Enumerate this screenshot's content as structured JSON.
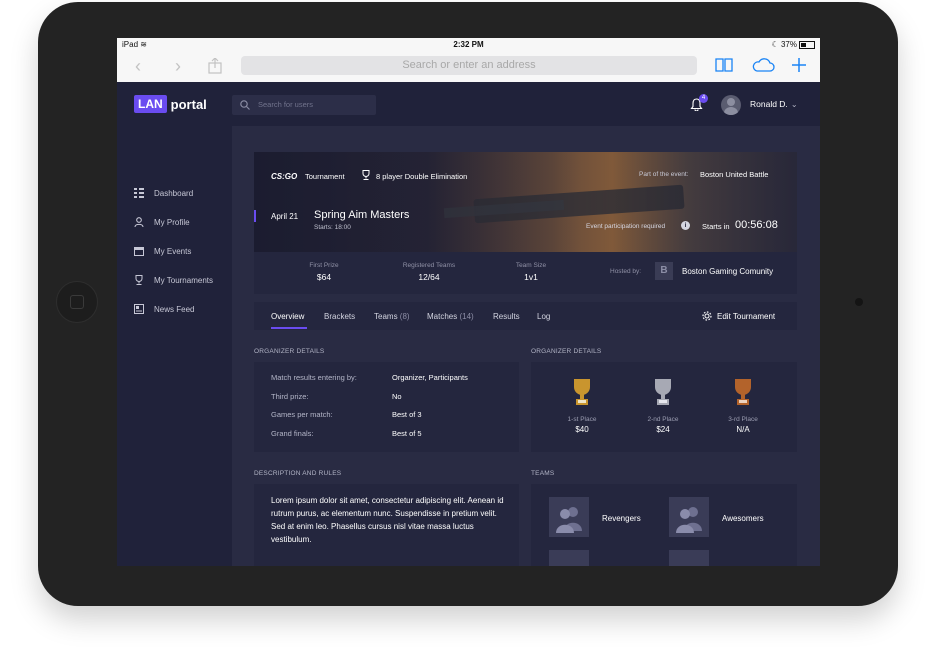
{
  "status_bar": {
    "device": "iPad",
    "time": "2:32 PM",
    "battery": "37%"
  },
  "browser": {
    "address_placeholder": "Search or enter an address"
  },
  "header": {
    "logo_lan": "LAN",
    "logo_portal": "portal",
    "search_placeholder": "Search for users",
    "notification_count": "4",
    "user_name": "Ronald D."
  },
  "sidebar": {
    "items": [
      {
        "label": "Dashboard",
        "icon": "dashboard-icon"
      },
      {
        "label": "My Profile",
        "icon": "profile-icon"
      },
      {
        "label": "My Events",
        "icon": "calendar-icon"
      },
      {
        "label": "My Tournaments",
        "icon": "trophy-icon"
      },
      {
        "label": "News Feed",
        "icon": "news-icon"
      }
    ]
  },
  "hero": {
    "game": "CS:GO",
    "type_label": "Tournament",
    "format": "8 player Double Elimination",
    "event_label": "Part of the event:",
    "event_name": "Boston United Battle",
    "date": "April 21",
    "title": "Spring Aim Masters",
    "starts_time": "Starts: 18:00",
    "participation_note": "Event participation required",
    "countdown_label": "Starts in",
    "countdown": "00:56:08"
  },
  "stats": {
    "first_prize_label": "First Prize",
    "first_prize": "$64",
    "registered_label": "Registered Teams",
    "registered": "12/64",
    "team_size_label": "Team Size",
    "team_size": "1v1",
    "hosted_label": "Hosted by:",
    "host_logo": "B",
    "host_name": "Boston Gaming Comunity"
  },
  "tabs": [
    {
      "label": "Overview",
      "count": ""
    },
    {
      "label": "Brackets",
      "count": ""
    },
    {
      "label": "Teams",
      "count": "(8)"
    },
    {
      "label": "Matches",
      "count": "(14)"
    },
    {
      "label": "Results",
      "count": ""
    },
    {
      "label": "Log",
      "count": ""
    }
  ],
  "edit_label": "Edit Tournament",
  "organizer": {
    "title": "ORGANIZER DETAILS",
    "rows": [
      {
        "label": "Match results entering by:",
        "value": "Organizer, Participants"
      },
      {
        "label": "Third prize:",
        "value": "No"
      },
      {
        "label": "Games per match:",
        "value": "Best of 3"
      },
      {
        "label": "Grand finals:",
        "value": "Best of 5"
      }
    ]
  },
  "prizes": {
    "title": "ORGANIZER DETAILS",
    "items": [
      {
        "place": "1-st Place",
        "value": "$40",
        "color": "#c9952e"
      },
      {
        "place": "2-nd Place",
        "value": "$24",
        "color": "#a7a9b4"
      },
      {
        "place": "3-rd Place",
        "value": "N/A",
        "color": "#b3632b"
      }
    ]
  },
  "description": {
    "title": "DESCRIPTION AND RULES",
    "text": "Lorem ipsum dolor sit amet, consectetur adipiscing elit. Aenean id rutrum purus, ac elementum nunc. Suspendisse in pretium velit. Sed at enim leo. Phasellus cursus nisl vitae massa luctus vestibulum."
  },
  "teams": {
    "title": "TEAMS",
    "items": [
      {
        "name": "Revengers"
      },
      {
        "name": "Awesomers"
      }
    ]
  },
  "colors": {
    "accent": "#6a4cf0",
    "background": "#292b43",
    "panel": "#24263e",
    "sidebar": "#20223a"
  }
}
